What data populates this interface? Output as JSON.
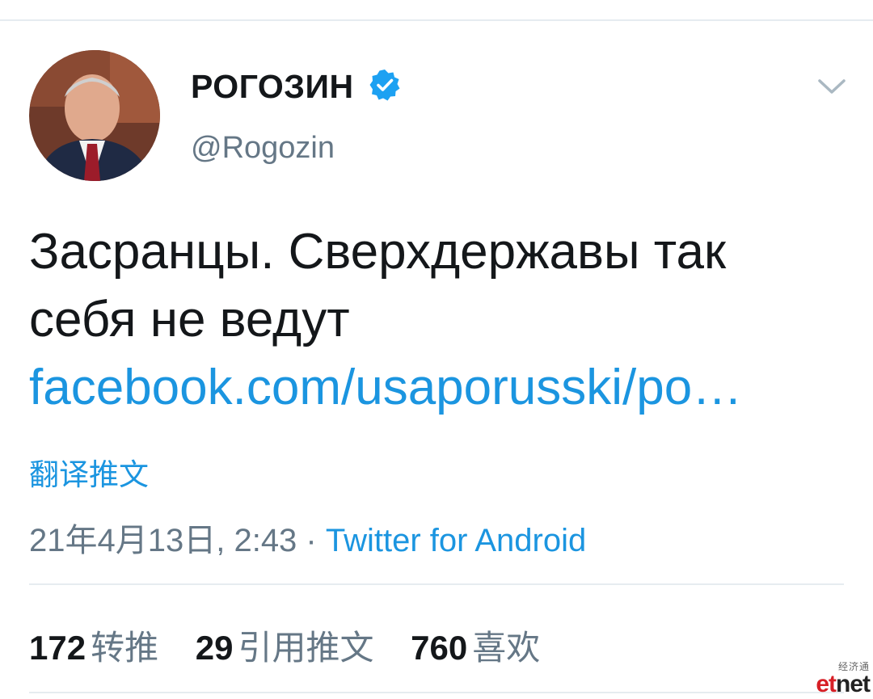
{
  "author": {
    "display_name": "РОГОЗИН",
    "handle": "@Rogozin",
    "verified": true
  },
  "tweet": {
    "line1": "Засранцы. Сверхдержавы так",
    "line2": "себя не ведут",
    "link_text": "facebook.com/usaporusski/po…"
  },
  "translate_label": "翻译推文",
  "meta": {
    "timestamp": "21年4月13日, 2:43",
    "separator": " · ",
    "source": "Twitter for Android"
  },
  "stats": {
    "retweets_count": "172",
    "retweets_label": "转推",
    "quotes_count": "29",
    "quotes_label": "引用推文",
    "likes_count": "760",
    "likes_label": "喜欢"
  },
  "watermark": {
    "cn": "经济通",
    "et": "et",
    "net": "net"
  },
  "colors": {
    "link_blue": "#1b95e0",
    "secondary_gray": "#657786",
    "text": "#14171a",
    "divider": "#e6ecf0"
  }
}
